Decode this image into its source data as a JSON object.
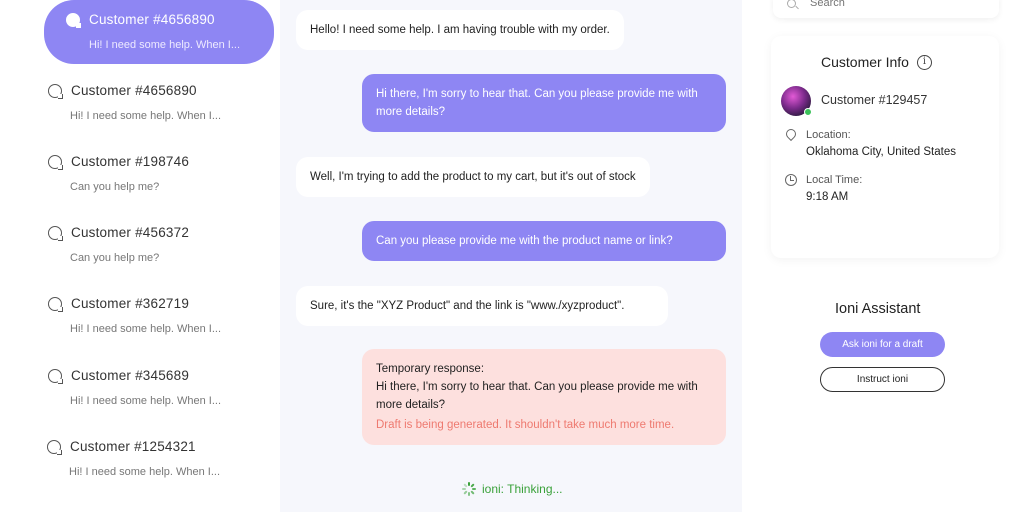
{
  "sidebar": {
    "conversations": [
      {
        "name": "Customer #4656890",
        "preview": "Hi! I need some help. When I...",
        "active": true
      },
      {
        "name": "Customer #4656890",
        "preview": "Hi! I need some help. When I..."
      },
      {
        "name": "Customer #198746",
        "preview": "Can you help me?"
      },
      {
        "name": "Customer #456372",
        "preview": "Can you help me?"
      },
      {
        "name": "Customer #362719",
        "preview": "Hi! I need some help. When I..."
      },
      {
        "name": "Customer #345689",
        "preview": "Hi! I need some help. When I..."
      },
      {
        "name": "Customer #1254321",
        "preview": "Hi! I need some help. When I..."
      }
    ]
  },
  "chat": {
    "messages": [
      {
        "direction": "in",
        "text": "Hello! I need some help. I am having trouble with my order."
      },
      {
        "direction": "out",
        "text": "Hi there, I'm sorry to hear that. Can you please provide me with more details?"
      },
      {
        "direction": "in",
        "text": "Well, I'm trying to add the product to my cart, but  it's out of stock"
      },
      {
        "direction": "out",
        "text": "Can you please provide me with the product name or link?"
      },
      {
        "direction": "in",
        "text": "Sure, it's the \"XYZ Product\" and the link is \"www./xyzproduct\"."
      }
    ],
    "draft": {
      "heading": "Temporary response:",
      "text": "Hi there, I'm sorry to hear that. Can you please provide me with more details?",
      "status": "Draft is being generated. It shouldn't take much more time."
    },
    "thinking": "ioni: Thinking..."
  },
  "search": {
    "placeholder": "Search"
  },
  "customer_info": {
    "title": "Customer Info",
    "name": "Customer #129457",
    "location_label": "Location:",
    "location": "Oklahoma City, United States",
    "time_label": "Local Time:",
    "time": "9:18 AM",
    "online": true
  },
  "assistant": {
    "title": "Ioni Assistant",
    "draft_button": "Ask ioni for a draft",
    "instruct_button": "Instruct ioni"
  },
  "colors": {
    "accent": "#8e86f3",
    "draft_bg": "#fde0de",
    "draft_status": "#ee7a70",
    "thinking": "#3aa13a",
    "online": "#3cc15a"
  }
}
